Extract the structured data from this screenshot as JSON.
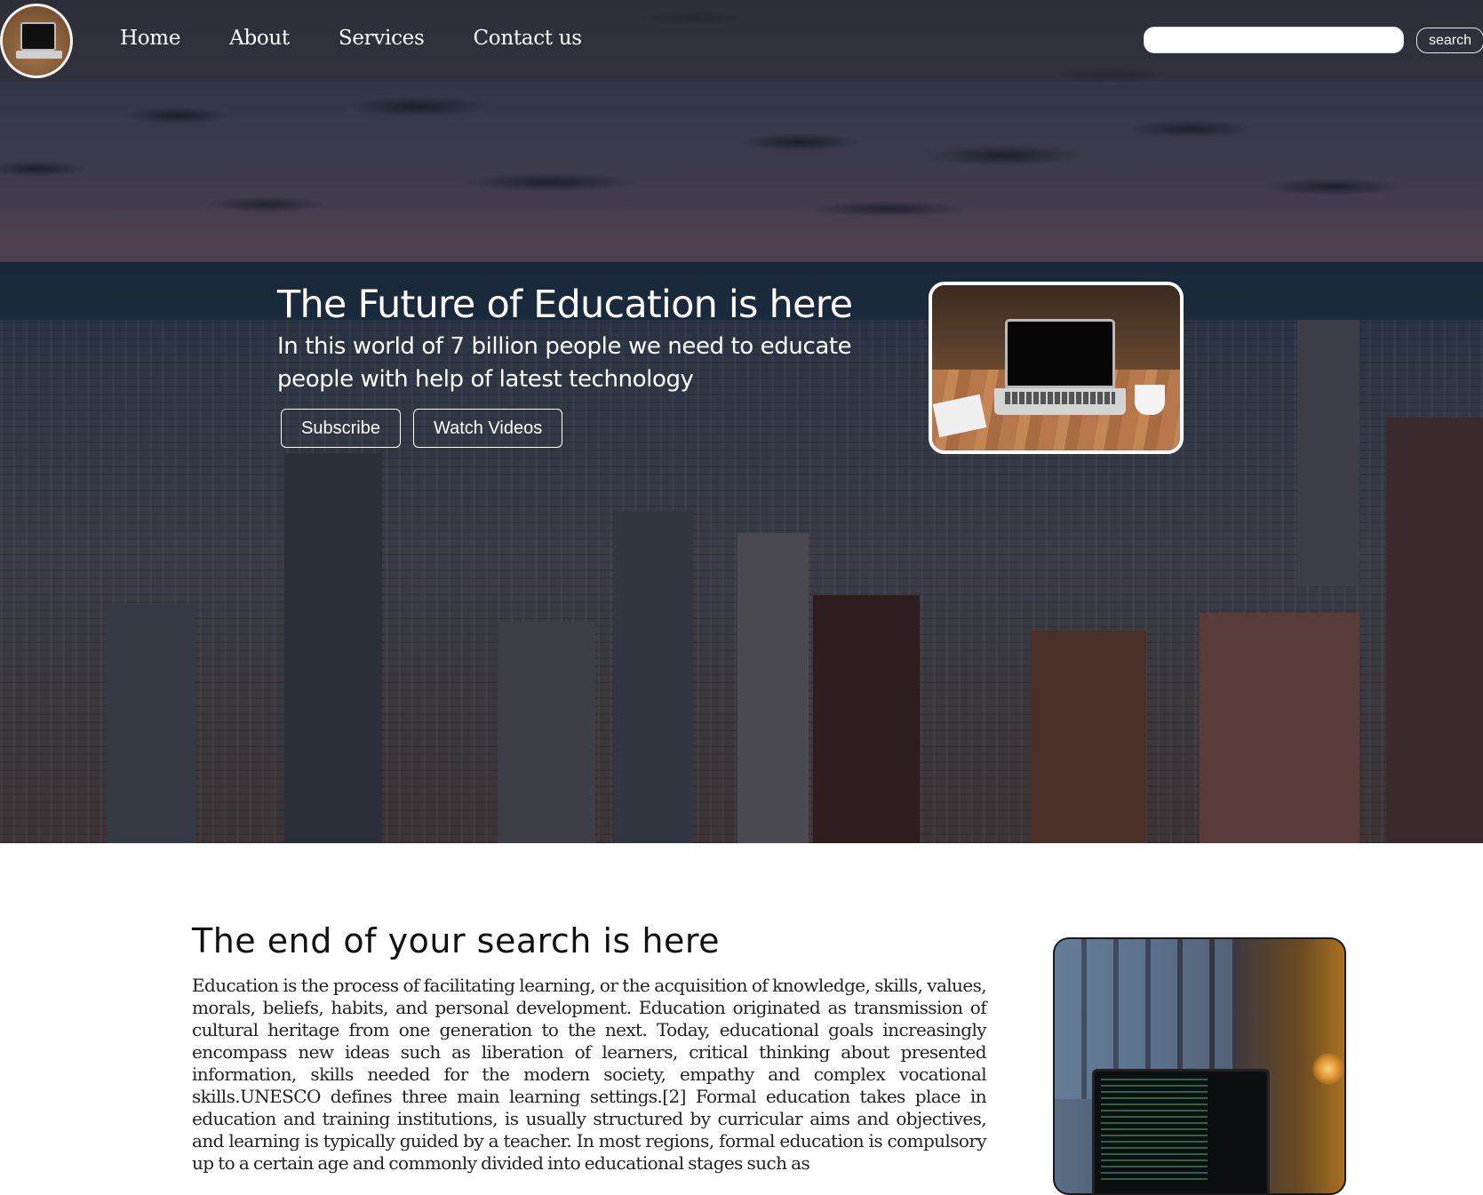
{
  "nav": {
    "logo_alt": "laptop logo",
    "links": [
      {
        "label": "Home"
      },
      {
        "label": "About"
      },
      {
        "label": "Services"
      },
      {
        "label": "Contact us"
      }
    ],
    "search": {
      "placeholder": "",
      "value": "",
      "button_label": "search"
    }
  },
  "hero": {
    "title": "The Future of Education is here",
    "subtitle": "In this world of 7 billion people we need to educate people with help of latest technology",
    "buttons": {
      "subscribe": "Subscribe",
      "watch": "Watch Videos"
    }
  },
  "section": {
    "title": "The end of your search is here",
    "body": "Education is the process of facilitating learning, or the acquisition of knowledge, skills, values, morals, beliefs, habits, and personal development. Education originated as transmission of cultural heritage from one generation to the next. Today, educational goals increasingly encompass new ideas such as liberation of learners, critical thinking about presented information, skills needed for the modern society, empathy and complex vocational skills.UNESCO defines three main learning settings.[2] Formal education takes place in education and training institutions, is usually structured by curricular aims and objectives, and learning is typically guided by a teacher. In most regions, formal education is compulsory up to a certain age and commonly divided into educational stages such as"
  },
  "colors": {
    "nav_overlay": "#2d2d34",
    "text_light": "#ffffff",
    "text_dark": "#111111"
  },
  "icons": [
    "laptop-logo-icon"
  ]
}
